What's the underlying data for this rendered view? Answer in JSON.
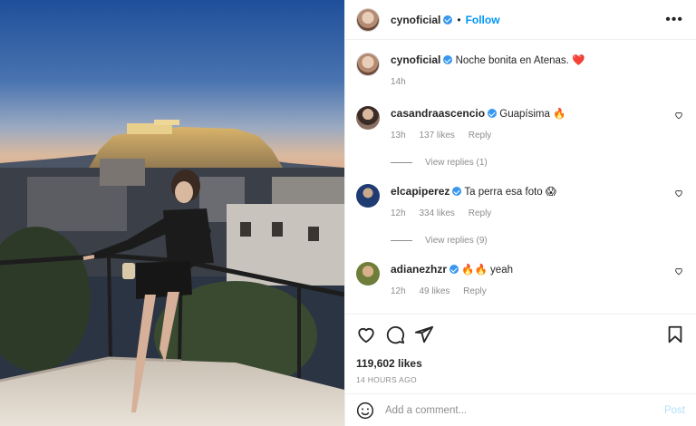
{
  "post": {
    "author": "cynoficial",
    "follow_label": "Follow",
    "separator": "•",
    "more_label": "•••"
  },
  "caption": {
    "username": "cynoficial",
    "text": "Noche bonita en Atenas. ❤️",
    "time": "14h"
  },
  "comments": [
    {
      "username": "casandraascencio",
      "verified": true,
      "text": "Guapísima 🔥",
      "time": "13h",
      "likes": "137 likes",
      "reply": "Reply",
      "view_replies": "View replies (1)"
    },
    {
      "username": "elcapiperez",
      "verified": true,
      "text": "Ta perra esa foto 😱",
      "time": "12h",
      "likes": "334 likes",
      "reply": "Reply",
      "view_replies": "View replies (9)"
    },
    {
      "username": "adianezhzr",
      "verified": true,
      "text": "🔥🔥 yeah",
      "time": "12h",
      "likes": "49 likes",
      "reply": "Reply"
    }
  ],
  "actions": {
    "like_icon": "heart-icon",
    "comment_icon": "comment-icon",
    "share_icon": "paper-plane-icon",
    "save_icon": "bookmark-icon"
  },
  "likes_count": "119,602 likes",
  "timestamp": "14 HOURS AGO",
  "add_comment": {
    "placeholder": "Add a comment...",
    "post_label": "Post",
    "emoji_icon": "smiley-icon"
  },
  "colors": {
    "accent": "#0095f6",
    "verified": "#3897f0",
    "heart": "#ed4956",
    "muted": "#8e8e8e"
  }
}
